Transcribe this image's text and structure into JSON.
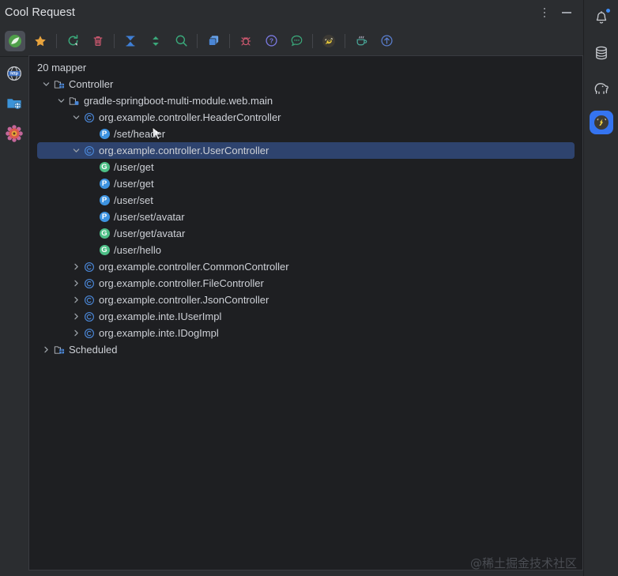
{
  "window": {
    "title": "Cool Request",
    "menu_icon": "more-vertical-icon",
    "minimize_icon": "minimize-icon"
  },
  "toolbar": {
    "items": [
      {
        "name": "spring-leaf-icon",
        "label": "Spring",
        "active": true
      },
      {
        "name": "star-icon",
        "label": "Favorites",
        "active": false
      },
      {
        "separator": true
      },
      {
        "name": "refresh-icon",
        "label": "Refresh",
        "active": false
      },
      {
        "name": "trash-icon",
        "label": "Delete",
        "active": false
      },
      {
        "separator": true
      },
      {
        "name": "collapse-all-icon",
        "label": "Collapse All",
        "active": false
      },
      {
        "name": "expand-all-icon",
        "label": "Expand All",
        "active": false
      },
      {
        "name": "search-icon",
        "label": "Search",
        "active": false
      },
      {
        "separator": true
      },
      {
        "name": "copy-icon",
        "label": "Copy",
        "active": false
      },
      {
        "separator": true
      },
      {
        "name": "bug-icon",
        "label": "Debug",
        "active": false
      },
      {
        "name": "help-icon",
        "label": "Help",
        "active": false
      },
      {
        "name": "chat-icon",
        "label": "Feedback",
        "active": false
      },
      {
        "separator": true
      },
      {
        "name": "bee-icon",
        "label": "Plugin",
        "active": false
      },
      {
        "separator": true
      },
      {
        "name": "coffee-icon",
        "label": "Java",
        "active": false
      },
      {
        "name": "upload-icon",
        "label": "Upload",
        "active": false
      }
    ]
  },
  "left_rail": {
    "items": [
      {
        "name": "http-globe-icon",
        "label": "HTTP"
      },
      {
        "name": "folder-globe-icon",
        "label": "Projects"
      },
      {
        "name": "settings-gear-icon",
        "label": "Settings"
      }
    ]
  },
  "right_rail": {
    "items": [
      {
        "name": "notifications-bell-icon",
        "label": "Notifications",
        "badge": true,
        "selected": false
      },
      {
        "name": "database-icon",
        "label": "Database",
        "badge": false,
        "selected": false
      },
      {
        "name": "elephant-icon",
        "label": "Gradle",
        "badge": false,
        "selected": false
      },
      {
        "name": "cool-request-icon",
        "label": "Cool Request",
        "badge": false,
        "selected": true
      }
    ]
  },
  "tree": {
    "header": "20 mapper",
    "nodes": [
      {
        "depth": 0,
        "state": "expanded",
        "icon": "module-folder-icon",
        "label": "Controller",
        "selected": false
      },
      {
        "depth": 1,
        "state": "expanded",
        "icon": "source-folder-icon",
        "label": "gradle-springboot-multi-module.web.main",
        "selected": false
      },
      {
        "depth": 2,
        "state": "expanded",
        "icon": "class-icon",
        "label": "org.example.controller.HeaderController",
        "selected": false
      },
      {
        "depth": 3,
        "state": "leaf",
        "icon": "post-badge",
        "label": "/set/header",
        "selected": false
      },
      {
        "depth": 2,
        "state": "expanded",
        "icon": "class-icon",
        "label": "org.example.controller.UserController",
        "selected": true
      },
      {
        "depth": 3,
        "state": "leaf",
        "icon": "get-badge",
        "label": "/user/get",
        "selected": false
      },
      {
        "depth": 3,
        "state": "leaf",
        "icon": "post-badge",
        "label": "/user/get",
        "selected": false
      },
      {
        "depth": 3,
        "state": "leaf",
        "icon": "post-badge",
        "label": "/user/set",
        "selected": false
      },
      {
        "depth": 3,
        "state": "leaf",
        "icon": "post-badge",
        "label": "/user/set/avatar",
        "selected": false
      },
      {
        "depth": 3,
        "state": "leaf",
        "icon": "get-badge",
        "label": "/user/get/avatar",
        "selected": false
      },
      {
        "depth": 3,
        "state": "leaf",
        "icon": "get-badge",
        "label": "/user/hello",
        "selected": false
      },
      {
        "depth": 2,
        "state": "collapsed",
        "icon": "class-icon",
        "label": "org.example.controller.CommonController",
        "selected": false
      },
      {
        "depth": 2,
        "state": "collapsed",
        "icon": "class-icon",
        "label": "org.example.controller.FileController",
        "selected": false
      },
      {
        "depth": 2,
        "state": "collapsed",
        "icon": "class-icon",
        "label": "org.example.controller.JsonController",
        "selected": false
      },
      {
        "depth": 2,
        "state": "collapsed",
        "icon": "class-icon",
        "label": "org.example.inte.IUserImpl",
        "selected": false
      },
      {
        "depth": 2,
        "state": "collapsed",
        "icon": "class-icon",
        "label": "org.example.inte.IDogImpl",
        "selected": false
      },
      {
        "depth": 0,
        "state": "collapsed",
        "icon": "module-folder-icon",
        "label": "Scheduled",
        "selected": false
      }
    ]
  },
  "watermark": "@稀土掘金技术社区",
  "colors": {
    "window_bg": "#2b2d30",
    "panel_bg": "#1e1f22",
    "selection": "#2e436e",
    "accent": "#3574f0",
    "get_badge": "#4dbf86",
    "post_badge": "#3d93e0",
    "text": "#cdd0d6"
  }
}
